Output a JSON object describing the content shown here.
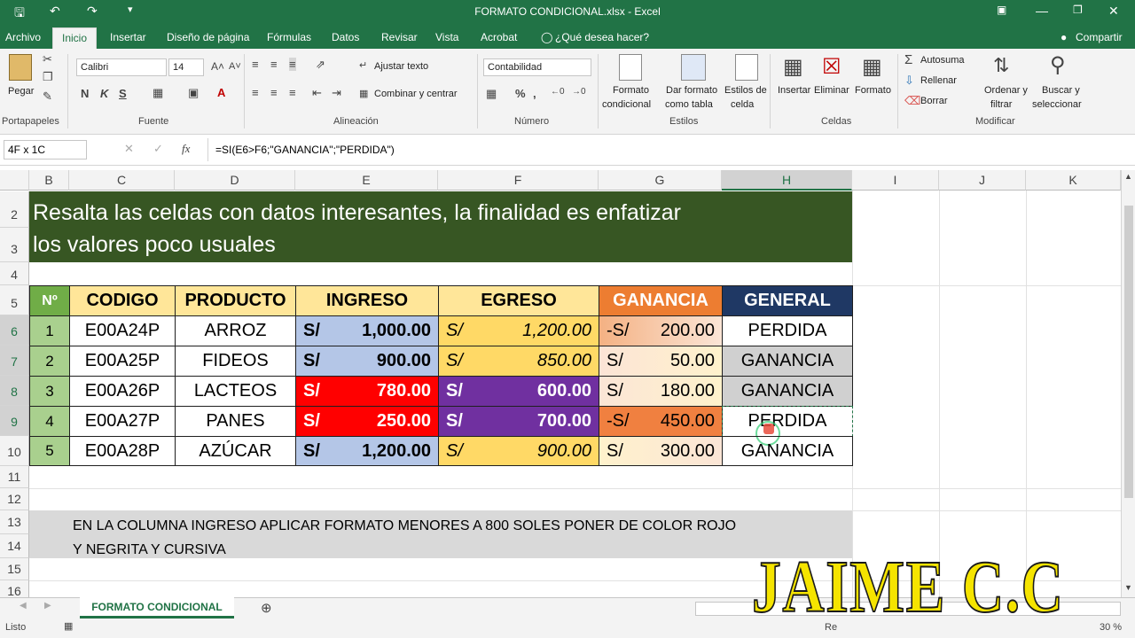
{
  "window": {
    "title": "FORMATO CONDICIONAL.xlsx - Excel"
  },
  "menu": {
    "file": "Archivo",
    "home": "Inicio",
    "insert": "Insertar",
    "layout": "Diseño de página",
    "formulas": "Fórmulas",
    "data": "Datos",
    "review": "Revisar",
    "view": "Vista",
    "acrobat": "Acrobat",
    "tell": "¿Qué desea hacer?",
    "share": "Compartir"
  },
  "ribbon": {
    "clipboard": {
      "paste": "Pegar",
      "group": "Portapapeles"
    },
    "font": {
      "name": "Calibri",
      "size": "14",
      "bold": "N",
      "italic": "K",
      "underline": "S",
      "group": "Fuente"
    },
    "alignment": {
      "wrap": "Ajustar texto",
      "merge": "Combinar y centrar",
      "group": "Alineación"
    },
    "number": {
      "format": "Contabilidad",
      "percent": "%",
      "group": "Número"
    },
    "styles": {
      "cond1": "Formato",
      "cond2": "condicional",
      "table1": "Dar formato",
      "table2": "como tabla",
      "cell1": "Estilos de",
      "cell2": "celda",
      "group": "Estilos"
    },
    "cells": {
      "insert": "Insertar",
      "delete": "Eliminar",
      "format": "Formato",
      "group": "Celdas"
    },
    "editing": {
      "autosum": "Autosuma",
      "fill": "Rellenar",
      "clear": "Borrar",
      "sort1": "Ordenar y",
      "sort2": "filtrar",
      "find1": "Buscar y",
      "find2": "seleccionar",
      "group": "Modificar"
    }
  },
  "formula_bar": {
    "name_box": "4F x 1C",
    "fx": "fx",
    "formula": "=SI(E6>F6;\"GANANCIA\";\"PERDIDA\")"
  },
  "columns": [
    "B",
    "C",
    "D",
    "E",
    "F",
    "G",
    "H",
    "I",
    "J",
    "K"
  ],
  "rows": [
    "2",
    "3",
    "4",
    "5",
    "6",
    "7",
    "8",
    "9",
    "10",
    "11",
    "12",
    "13",
    "14",
    "15",
    "16"
  ],
  "banner": {
    "line1": "Resalta las celdas con datos interesantes, la finalidad  es enfatizar",
    "line2": "los valores poco usuales"
  },
  "table": {
    "headers": {
      "num": "Nº",
      "code": "CODIGO",
      "product": "PRODUCTO",
      "income": "INGRESO",
      "expense": "EGRESO",
      "profit": "GANANCIA",
      "general": "GENERAL"
    },
    "rows": [
      {
        "num": "1",
        "code": "E00A24P",
        "product": "ARROZ",
        "inc_cur": "S/",
        "income": "1,000.00",
        "exp_cur": "S/",
        "expense": "1,200.00",
        "pro_cur": "-S/",
        "profit": "200.00",
        "general": "PERDIDA"
      },
      {
        "num": "2",
        "code": "E00A25P",
        "product": "FIDEOS",
        "inc_cur": "S/",
        "income": "900.00",
        "exp_cur": "S/",
        "expense": "850.00",
        "pro_cur": "S/",
        "profit": "50.00",
        "general": "GANANCIA"
      },
      {
        "num": "3",
        "code": "E00A26P",
        "product": "LACTEOS",
        "inc_cur": "S/",
        "income": "780.00",
        "exp_cur": "S/",
        "expense": "600.00",
        "pro_cur": "S/",
        "profit": "180.00",
        "general": "GANANCIA"
      },
      {
        "num": "4",
        "code": "E00A27P",
        "product": "PANES",
        "inc_cur": "S/",
        "income": "250.00",
        "exp_cur": "S/",
        "expense": "700.00",
        "pro_cur": "-S/",
        "profit": "450.00",
        "general": "PERDIDA"
      },
      {
        "num": "5",
        "code": "E00A28P",
        "product": "AZÚCAR",
        "inc_cur": "S/",
        "income": "1,200.00",
        "exp_cur": "S/",
        "expense": "900.00",
        "pro_cur": "S/",
        "profit": "300.00",
        "general": "GANANCIA"
      }
    ]
  },
  "note": {
    "line1": "EN LA COLUMNA INGRESO APLICAR FORMATO MENORES A 800 SOLES  PONER DE COLOR ROJO",
    "line2": "Y NEGRITA Y CURSIVA"
  },
  "sheet_tab": "FORMATO CONDICIONAL",
  "status": {
    "ready": "Listo",
    "zoom": "30 %",
    "partial": "Re"
  },
  "watermark": "JAIME C.C",
  "colors": {
    "excel_green": "#217346",
    "banner": "#375623",
    "header_green": "#70ad47",
    "header_yellow": "#ffe699",
    "header_orange": "#ed7d31",
    "header_navy": "#1f3864",
    "red": "#ff0000",
    "purple": "#7030a0",
    "income_blue": "#b4c6e7",
    "watermark": "#f5e400"
  }
}
